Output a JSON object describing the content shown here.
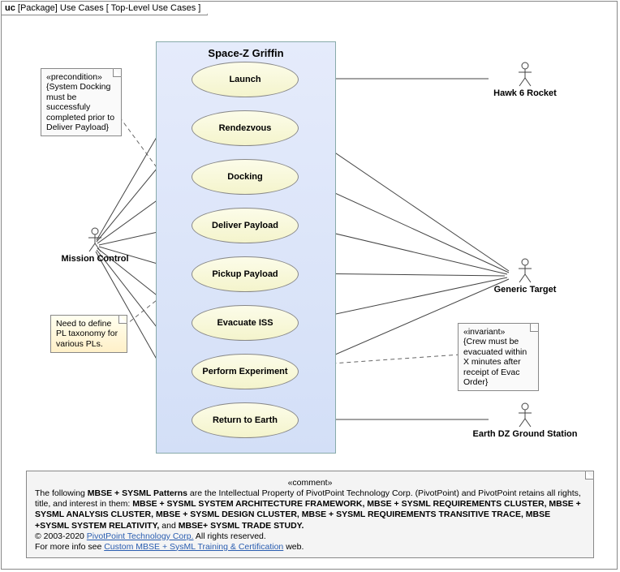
{
  "frame": {
    "prefix": "uc",
    "kind": "[Package]",
    "name": "Use Cases",
    "qualifier": "[ Top-Level Use Cases ]"
  },
  "boundary": {
    "title": "Space-Z Griffin"
  },
  "usecases": {
    "launch": "Launch",
    "rendezvous": "Rendezvous",
    "docking": "Docking",
    "deliver": "Deliver Payload",
    "pickup": "Pickup Payload",
    "evacuate": "Evacuate ISS",
    "experiment": "Perform Experiment",
    "return": "Return to Earth"
  },
  "actors": {
    "mission": "Mission Control",
    "hawk": "Hawk 6 Rocket",
    "target": "Generic Target",
    "earthdz": "Earth DZ Ground Station"
  },
  "notes": {
    "precondition_stereo": "«precondition»",
    "precondition_text": "{System Docking must be successfuly completed prior to Deliver Payload}",
    "taxonomy": "Need to define PL taxonomy for various PLs.",
    "invariant_stereo": "«invariant»",
    "invariant_text": "{Crew must be evacuated within X minutes after receipt of Evac Order}"
  },
  "comment": {
    "stereo": "«comment»",
    "line1_a": "The following ",
    "line1_b": "MBSE + SYSML Patterns",
    "line1_c": " are the Intellectual Property of PivotPoint Technology Corp. (PivotPoint) and PivotPoint retains all rights, title, and interest in them: ",
    "patterns": "MBSE + SYSML SYSTEM ARCHITECTURE FRAMEWORK, MBSE + SYSML REQUIREMENTS CLUSTER, MBSE + SYSML ANALYSIS CLUSTER, MBSE + SYSML DESIGN CLUSTER, MBSE + SYSML REQUIREMENTS TRANSITIVE TRACE, MBSE +SYSML SYSTEM RELATIVITY, ",
    "and": "and ",
    "last_pattern": "MBSE+ SYSML TRADE STUDY.",
    "copyright_a": "© 2003-2020 ",
    "copyright_link": "PivotPoint Technology Corp.",
    "copyright_b": " All rights reserved.",
    "info_a": "For more info see ",
    "info_link": "Custom MBSE + SysML Training & Certification",
    "info_b": " web."
  }
}
